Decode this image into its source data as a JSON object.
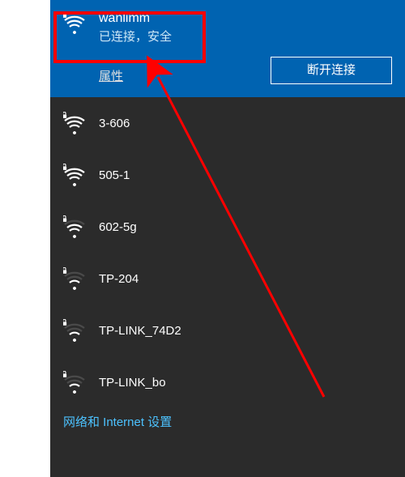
{
  "connected": {
    "name": "wanlimm",
    "status": "已连接，安全",
    "properties_label": "属性",
    "disconnect_label": "断开连接"
  },
  "networks": [
    {
      "name": "3-606",
      "secured": true,
      "strength": 4
    },
    {
      "name": "505-1",
      "secured": true,
      "strength": 4
    },
    {
      "name": "602-5g",
      "secured": true,
      "strength": 3
    },
    {
      "name": "TP-204",
      "secured": true,
      "strength": 2
    },
    {
      "name": "TP-LINK_74D2",
      "secured": true,
      "strength": 2
    },
    {
      "name": "TP-LINK_bo",
      "secured": true,
      "strength": 2
    }
  ],
  "settings_label": "网络和 Internet 设置",
  "icons": {
    "wifi": "wifi-secured-icon"
  },
  "colors": {
    "accent": "#0063b1",
    "panel_bg": "#2b2b2b",
    "link": "#4cc2ff",
    "annotation": "#ff0000"
  }
}
